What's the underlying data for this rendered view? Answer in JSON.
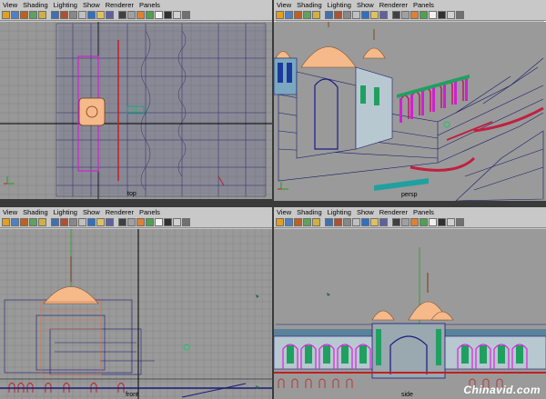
{
  "menus": [
    "View",
    "Shading",
    "Lighting",
    "Show",
    "Renderer",
    "Panels"
  ],
  "toolbar_icon_colors": [
    "#e0a020",
    "#5080c0",
    "#c06020",
    "#60a060",
    "#d0b040",
    "#4070b0",
    "#b05030",
    "#888888",
    "#c0c0c0",
    "#3070c0",
    "#e0c060",
    "#6060a0",
    "#404040",
    "#a0a0a0",
    "#e08030",
    "#50a050",
    "#f0f0f0",
    "#303030",
    "#d0d0d0",
    "#707070"
  ],
  "panels": [
    {
      "id": "top-left",
      "camera_label": "top"
    },
    {
      "id": "top-right",
      "camera_label": "persp"
    },
    {
      "id": "bottom-left",
      "camera_label": "front"
    },
    {
      "id": "bottom-right",
      "camera_label": "side"
    }
  ],
  "colors": {
    "viewport_bg": "#989898",
    "grid": "#7a7a7a",
    "wire_blue": "#1a1a7a",
    "dome": "#f5b98a",
    "magenta": "#e020e0",
    "green": "#20a060",
    "red": "#c02020"
  },
  "watermark": "Chinavid.com"
}
